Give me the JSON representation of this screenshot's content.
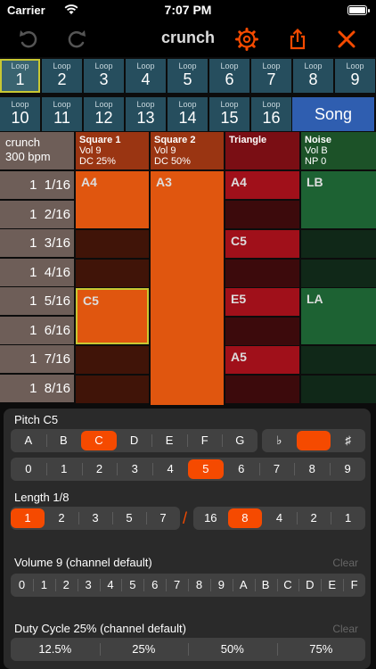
{
  "status": {
    "carrier": "Carrier",
    "time": "7:07 PM"
  },
  "toolbar": {
    "title": "crunch",
    "icons": [
      "undo-icon",
      "redo-icon",
      "gear-icon",
      "share-icon",
      "close-icon"
    ],
    "accent": "#f54a00"
  },
  "loops": {
    "label": "Loop",
    "numbers": [
      "1",
      "2",
      "3",
      "4",
      "5",
      "6",
      "7",
      "8",
      "9",
      "10",
      "11",
      "12",
      "13",
      "14",
      "15",
      "16"
    ],
    "selected": "1",
    "song_label": "Song"
  },
  "song_info": {
    "name": "crunch",
    "tempo": "300 bpm"
  },
  "channels": [
    {
      "name": "Square 1",
      "line1": "Vol 9",
      "line2": "DC 25%"
    },
    {
      "name": "Square 2",
      "line1": "Vol 9",
      "line2": "DC 50%"
    },
    {
      "name": "Triangle",
      "line1": "",
      "line2": ""
    },
    {
      "name": "Noise",
      "line1": "Vol B",
      "line2": "NP 0"
    }
  ],
  "rows": [
    {
      "bar": "1",
      "step": "1/16"
    },
    {
      "bar": "1",
      "step": "2/16"
    },
    {
      "bar": "1",
      "step": "3/16"
    },
    {
      "bar": "1",
      "step": "4/16"
    },
    {
      "bar": "1",
      "step": "5/16"
    },
    {
      "bar": "1",
      "step": "6/16"
    },
    {
      "bar": "1",
      "step": "7/16"
    },
    {
      "bar": "1",
      "step": "8/16"
    }
  ],
  "notes": {
    "square1": [
      "A4",
      "",
      "",
      "",
      "C5",
      "",
      "",
      ""
    ],
    "square2": [
      "A3"
    ],
    "triangle": [
      "A4",
      "",
      "C5",
      "",
      "E5",
      "",
      "A5",
      ""
    ],
    "noise": [
      "LB",
      "",
      "",
      "",
      "LA",
      "",
      "",
      ""
    ]
  },
  "panel": {
    "pitch_title": "Pitch C5",
    "pitch_notes": [
      "A",
      "B",
      "C",
      "D",
      "E",
      "F",
      "G"
    ],
    "pitch_selected": "C",
    "accidentals": [
      "♭",
      "",
      "♯"
    ],
    "octaves": [
      "0",
      "1",
      "2",
      "3",
      "4",
      "5",
      "6",
      "7",
      "8",
      "9"
    ],
    "octave_selected": "5",
    "length_title": "Length 1/8",
    "length_a": [
      "1",
      "2",
      "3",
      "5",
      "7"
    ],
    "length_a_selected": "1",
    "slash": "/",
    "length_b": [
      "16",
      "8",
      "4",
      "2",
      "1"
    ],
    "length_b_selected": "8",
    "volume_title": "Volume 9 (channel default)",
    "volume_clear": "Clear",
    "volume_values": [
      "0",
      "1",
      "2",
      "3",
      "4",
      "5",
      "6",
      "7",
      "8",
      "9",
      "A",
      "B",
      "C",
      "D",
      "E",
      "F"
    ],
    "duty_title": "Duty Cycle 25% (channel default)",
    "duty_clear": "Clear",
    "duty_values": [
      "12.5%",
      "25%",
      "50%",
      "75%"
    ]
  }
}
